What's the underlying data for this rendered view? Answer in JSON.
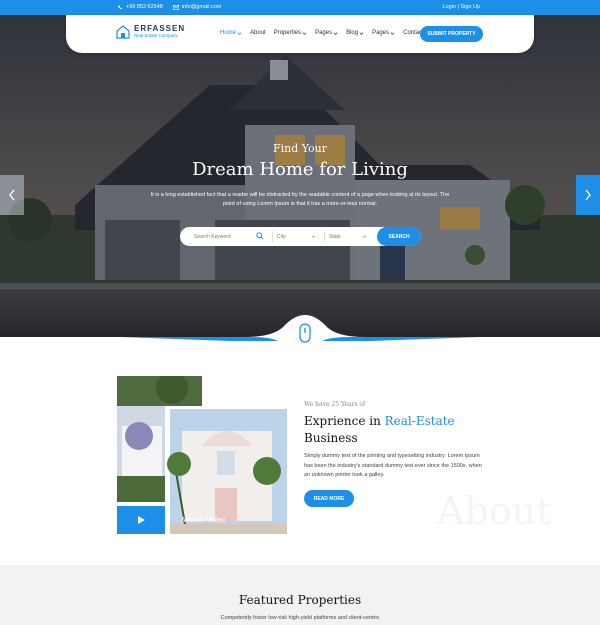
{
  "topbar": {
    "phone": "+99 852 62548",
    "email": "info@gmail.com",
    "auth": "Login | Sign Up"
  },
  "brand": {
    "name": "ERFASSEN",
    "tagline": "Real Estate Company"
  },
  "nav": {
    "items": [
      {
        "label": "Home",
        "dropdown": true,
        "active": true
      },
      {
        "label": "About",
        "dropdown": false,
        "active": false
      },
      {
        "label": "Properties",
        "dropdown": true,
        "active": false
      },
      {
        "label": "Pages",
        "dropdown": true,
        "active": false
      },
      {
        "label": "Blog",
        "dropdown": true,
        "active": false
      },
      {
        "label": "Pages",
        "dropdown": true,
        "active": false
      },
      {
        "label": "Contact",
        "dropdown": false,
        "active": false
      }
    ],
    "submit_label": "SUBMIT PROPERTY"
  },
  "hero": {
    "subtitle": "Find Your",
    "title": "Dream Home for Living",
    "description": "It is a long established fact that a reader will be distracted by the readable content of a page when looking at its layout. The point of using Lorem Ipsum is that it has a more-or-less normal.",
    "search": {
      "keyword_placeholder": "Search Keyword",
      "city": "City",
      "state": "State",
      "button": "SEARCH"
    }
  },
  "about": {
    "watch_label": "Watch Video",
    "we_have": "We have 25 Years of",
    "title_part1": "Exprience in ",
    "title_accent": "Real-Estate",
    "title_part2": "Business",
    "text": "Simply dummy text of the printing and typesetting industry. Lorem Ipsum has been the industry's standard dummy text ever since the 1500s, when an unknown printer took a galley.",
    "button": "READ MORE",
    "bg_word": "About"
  },
  "featured": {
    "title": "Featured Properties",
    "subtitle": "Competently foster low-risk high-yield platforms and client-centric"
  },
  "colors": {
    "accent": "#1e8fe8",
    "dark": "#1e3a64"
  }
}
